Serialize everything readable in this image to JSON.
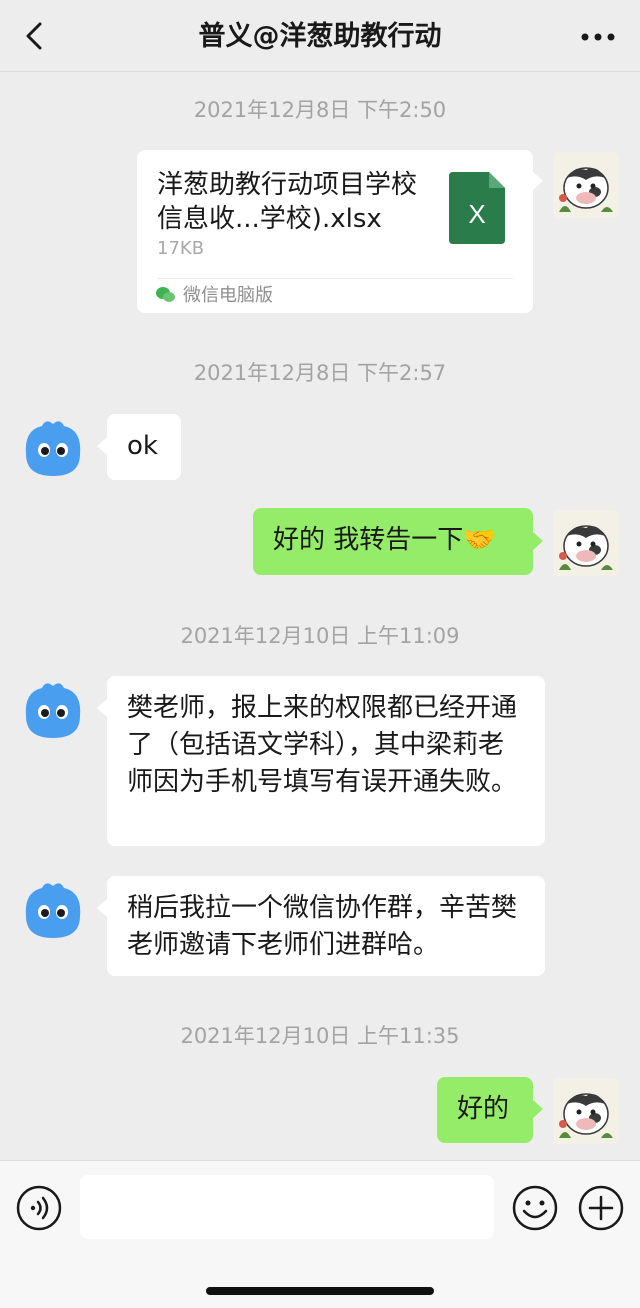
{
  "header": {
    "title": "普义@洋葱助教行动"
  },
  "messages": {
    "t1": "2021年12月8日 下午2:50",
    "file": {
      "name": "洋葱助教行动项目学校信息收...学校).xlsx",
      "size": "17KB",
      "source": "微信电脑版",
      "type_label": "X"
    },
    "t2": "2021年12月8日 下午2:57",
    "m1": "ok",
    "m2": "好的 我转告一下🤝",
    "t3": "2021年12月10日 上午11:09",
    "m3": "樊老师，报上来的权限都已经开通了（包括语文学科），其中梁莉老师因为手机号填写有误开通失败。",
    "m4": "稍后我拉一个微信协作群，辛苦樊老师邀请下老师们进群哈。",
    "t4": "2021年12月10日 上午11:35",
    "m5": "好的"
  },
  "icons": {
    "back": "chevron-left-icon",
    "more": "more-dots-icon",
    "voice": "voice-icon",
    "emoji": "emoji-icon",
    "plus": "plus-icon"
  },
  "colors": {
    "background": "#ededed",
    "bubble_self": "#95ec69",
    "bubble_other": "#ffffff",
    "excel_green": "#2a7d4a",
    "avatar_blue": "#4a9ef0"
  }
}
